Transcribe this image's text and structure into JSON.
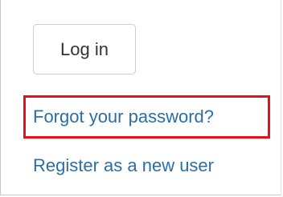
{
  "login": {
    "button_label": "Log in"
  },
  "links": {
    "forgot_password": "Forgot your password?",
    "register": "Register as a new user"
  },
  "colors": {
    "link": "#2a6ea8",
    "highlight_border": "#e8101a",
    "button_border": "#cccccc",
    "button_text": "#333333"
  }
}
